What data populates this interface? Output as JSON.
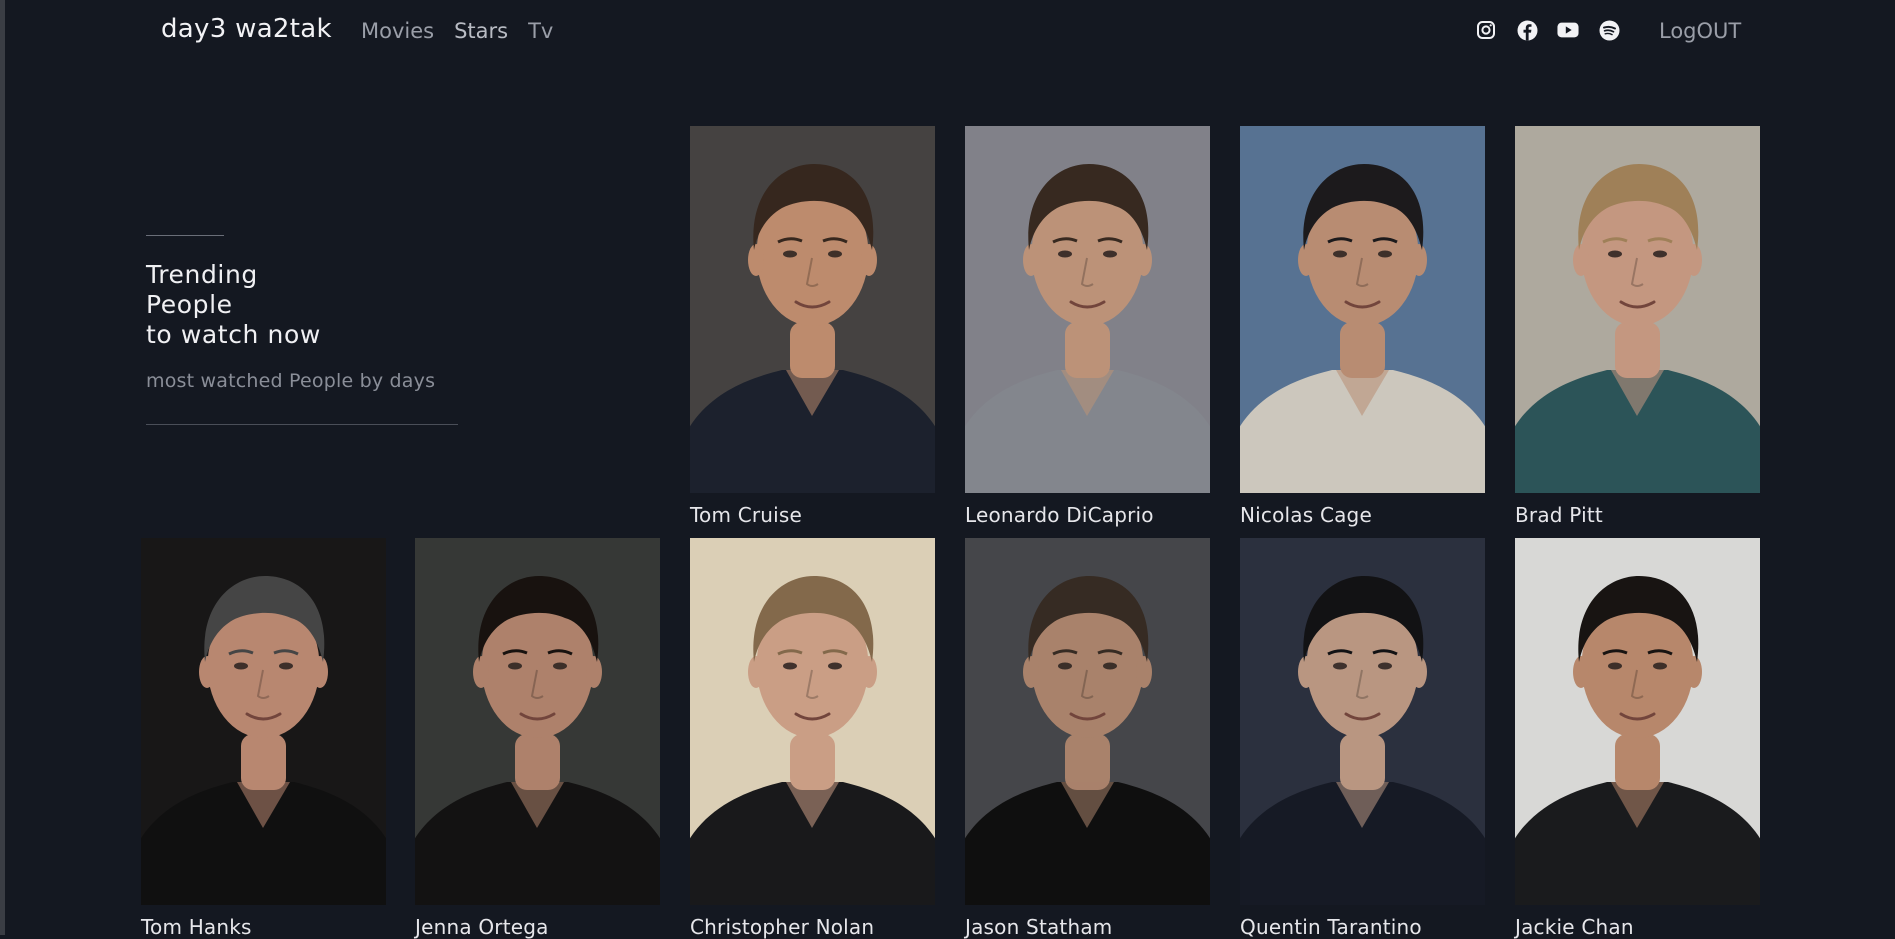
{
  "navbar": {
    "brand": "day3 wa2tak",
    "links": [
      {
        "label": "Movies"
      },
      {
        "label": "Stars"
      },
      {
        "label": "Tv"
      }
    ],
    "socials": [
      "instagram-icon",
      "facebook-icon",
      "youtube-icon",
      "spotify-icon"
    ],
    "logout_label": "LogOUT"
  },
  "hero": {
    "title_lines": [
      "Trending",
      "People",
      "to watch now"
    ],
    "subtitle": "most watched People by days"
  },
  "people": [
    {
      "name": "Tom Cruise",
      "bg": "#4a4746",
      "skin": "#c99474",
      "hair": "#3a2a20",
      "clothes": "#1e2430"
    },
    {
      "name": "Leonardo DiCaprio",
      "bg": "#8a8a92",
      "skin": "#c89c80",
      "hair": "#3b2c22",
      "clothes": "#8c8f96"
    },
    {
      "name": "Nicolas Cage",
      "bg": "#5d7a9c",
      "skin": "#c4957a",
      "hair": "#1e1c1e",
      "clothes": "#d9d4c9"
    },
    {
      "name": "Brad Pitt",
      "bg": "#b9b4a8",
      "skin": "#d1a188",
      "hair": "#a9895e",
      "clothes": "#2f5a5e"
    },
    {
      "name": "Tom Hanks",
      "bg": "#1a1919",
      "skin": "#c49078",
      "hair": "#4a4a4a",
      "clothes": "#121212"
    },
    {
      "name": "Jenna Ortega",
      "bg": "#3a3c3a",
      "skin": "#b98a72",
      "hair": "#1a1410",
      "clothes": "#151414"
    },
    {
      "name": "Christopher Nolan",
      "bg": "#e9dcc2",
      "skin": "#d7a88e",
      "hair": "#8c7050",
      "clothes": "#1b1b1d"
    },
    {
      "name": "Jason Statham",
      "bg": "#4a4b4f",
      "skin": "#b48b72",
      "hair": "#3a2e26",
      "clothes": "#101010"
    },
    {
      "name": "Quentin Tarantino",
      "bg": "#2e3342",
      "skin": "#c5a08a",
      "hair": "#141416",
      "clothes": "#181c28"
    },
    {
      "name": "Jackie Chan",
      "bg": "#e6e6e4",
      "skin": "#c39072",
      "hair": "#1a1614",
      "clothes": "#1c1d1f"
    }
  ]
}
